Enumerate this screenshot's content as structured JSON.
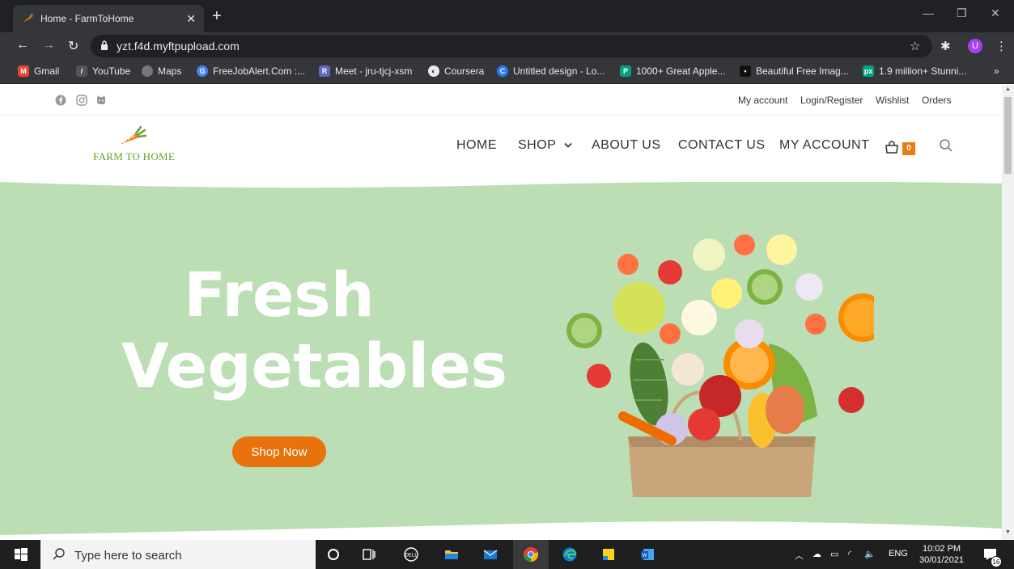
{
  "browser": {
    "tab_title": "Home - FarmToHome",
    "url": "yzt.f4d.myftpupload.com",
    "profile_initial": "U",
    "bookmarks": [
      {
        "label": "Gmail",
        "icon": "gmail-icon"
      },
      {
        "label": "YouTube",
        "icon": "youtube-icon"
      },
      {
        "label": "Maps",
        "icon": "maps-icon"
      },
      {
        "label": "FreeJobAlert.Com :...",
        "icon": "freejobalert-icon"
      },
      {
        "label": "Meet - jru-tjcj-xsm",
        "icon": "meet-icon"
      },
      {
        "label": "Coursera",
        "icon": "coursera-icon"
      },
      {
        "label": "Untitled design - Lo...",
        "icon": "canva-icon"
      },
      {
        "label": "1000+ Great Apple...",
        "icon": "pexels-icon"
      },
      {
        "label": "Beautiful Free Imag...",
        "icon": "unsplash-icon"
      },
      {
        "label": "1.9 million+ Stunni...",
        "icon": "pixabay-icon"
      }
    ],
    "bookmarks_more": "»"
  },
  "site": {
    "top_links": [
      "My account",
      "Login/Register",
      "Wishlist",
      "Orders"
    ],
    "logo_text": "FARM TO HOME",
    "nav": [
      "HOME",
      "SHOP",
      "ABOUT US",
      "CONTACT US",
      "MY ACCOUNT"
    ],
    "cart_count": "0",
    "hero": {
      "line1": "Fresh",
      "line2": "Vegetables",
      "button": "Shop Now"
    },
    "colors": {
      "accent": "#e8720c",
      "hero_bg": "#bcdeb4",
      "logo_green": "#6a9e2e"
    }
  },
  "taskbar": {
    "search_placeholder": "Type here to search",
    "lang": "ENG",
    "time": "10:02 PM",
    "date": "30/01/2021",
    "notifications": "16"
  }
}
